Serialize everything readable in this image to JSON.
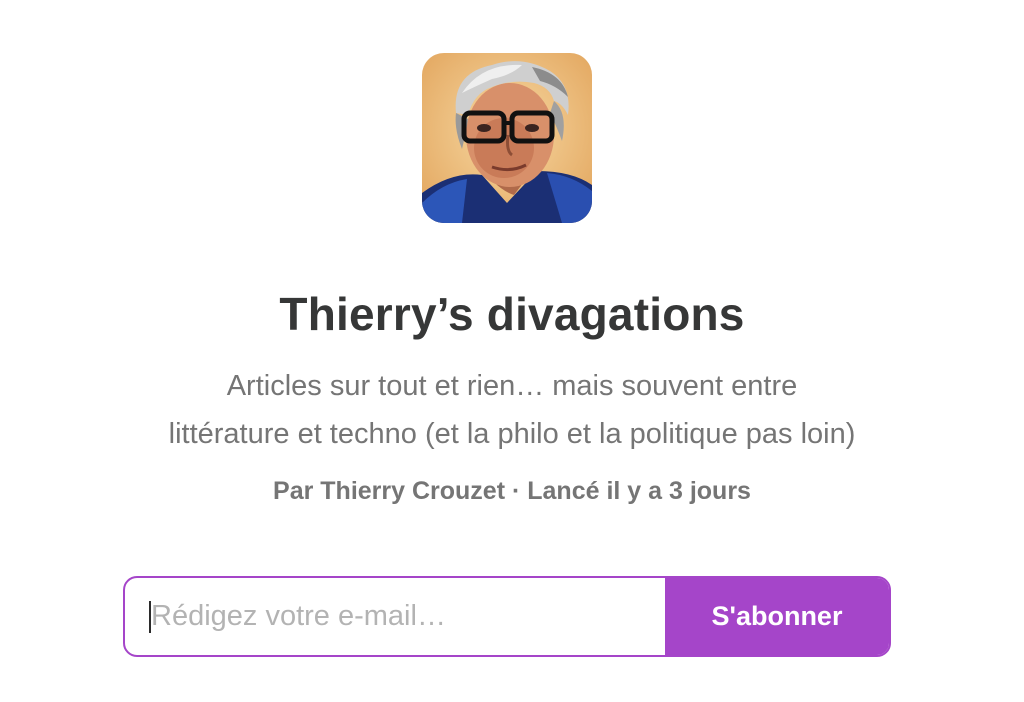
{
  "publication": {
    "title": "Thierry’s divagations",
    "description_line1": "Articles sur tout et rien… mais souvent entre",
    "description_line2": "littérature et techno (et la philo et la politique pas loin)",
    "meta": "Par Thierry Crouzet · Lancé il y a 3 jours"
  },
  "subscribe": {
    "email_placeholder": "Rédigez votre e-mail…",
    "email_value": "",
    "button_label": "S'abonner"
  },
  "colors": {
    "accent": "#a545c9",
    "title": "#363737",
    "muted": "#757575"
  }
}
